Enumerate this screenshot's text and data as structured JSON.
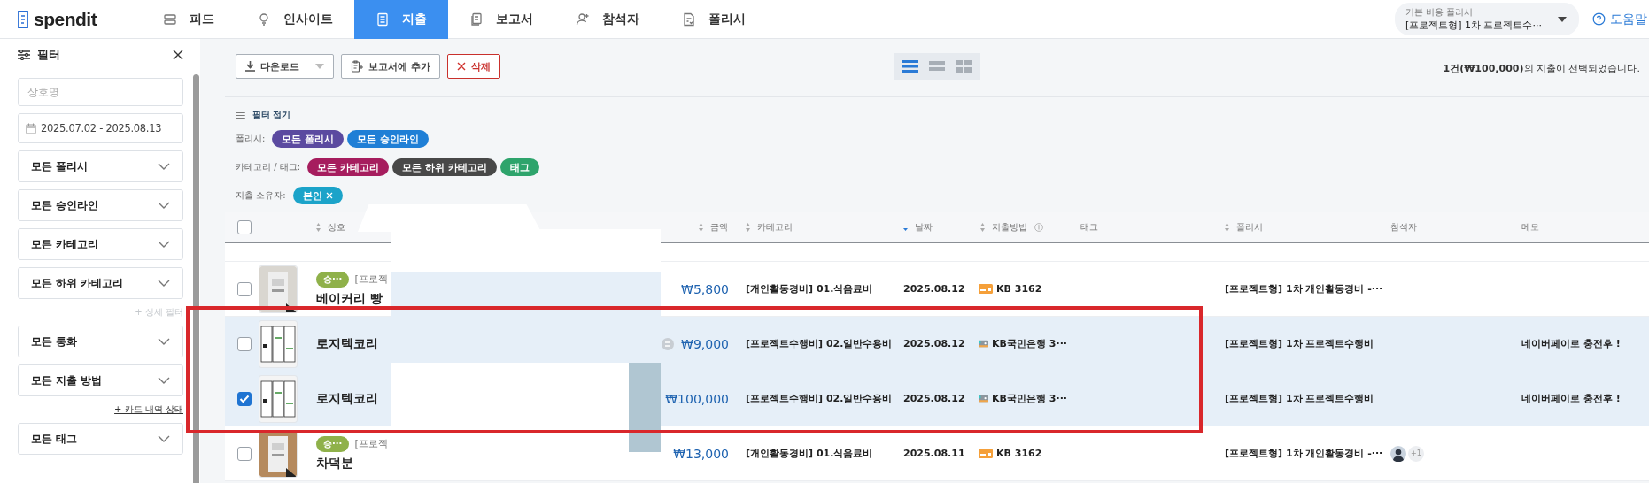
{
  "nav": {
    "logo": "spendit",
    "items": [
      {
        "label": "피드",
        "selected": false
      },
      {
        "label": "인사이트",
        "selected": false
      },
      {
        "label": "지출",
        "selected": true
      },
      {
        "label": "보고서",
        "selected": false
      },
      {
        "label": "참석자",
        "selected": false
      },
      {
        "label": "폴리시",
        "selected": false
      }
    ],
    "policy_selector": {
      "label": "기본 비용 폴리시",
      "value": "[프로젝트형] 1차 프로젝트수···"
    },
    "help": "도움말"
  },
  "filter_panel": {
    "title": "필터",
    "fields": [
      {
        "kind": "input",
        "placeholder": "상호명"
      },
      {
        "kind": "date",
        "value": "2025.07.02 - 2025.08.13"
      },
      {
        "kind": "select",
        "value": "모든 폴리시"
      },
      {
        "kind": "select",
        "value": "모든 승인라인"
      },
      {
        "kind": "select",
        "value": "모든 카테고리"
      },
      {
        "kind": "select",
        "value": "모든 하위 카테고리"
      },
      {
        "kind": "more",
        "label": "+ 상세 필터"
      },
      {
        "kind": "select",
        "value": "모든 통화"
      },
      {
        "kind": "select",
        "value": "모든 지출 방법"
      },
      {
        "kind": "link",
        "label": "+ 카드 내역 상태"
      },
      {
        "kind": "select",
        "value": "모든 태그"
      }
    ]
  },
  "toolbar": {
    "buttons": [
      {
        "kind": "download",
        "label": "다운로드"
      },
      {
        "kind": "report",
        "label": "보고서에 추가"
      },
      {
        "kind": "delete",
        "label": "삭제"
      }
    ],
    "views": [
      {
        "kind": "list",
        "selected": true
      },
      {
        "kind": "compact",
        "selected": false
      },
      {
        "kind": "grid",
        "selected": false
      }
    ],
    "selection_summary": "**1건(₩100,000)**의 지출이 선택되었습니다."
  },
  "filters": {
    "toggle": "필터 접기",
    "groups": [
      {
        "label": "폴리시:",
        "chips": [
          {
            "label": "모든 폴리시",
            "color": "#5b4aa0",
            "removable": false
          },
          {
            "label": "모든 승인라인",
            "color": "#1f7fd6",
            "removable": false
          }
        ]
      },
      {
        "label": "카테고리 / 태그:",
        "chips": [
          {
            "label": "모든 카테고리",
            "color": "#a61d5e",
            "removable": false
          },
          {
            "label": "모든 하위 카테고리",
            "color": "#484848",
            "removable": false
          },
          {
            "label": "태그",
            "color": "#2ea46c",
            "removable": false
          }
        ]
      },
      {
        "label": "지출 소유자:",
        "chips": [
          {
            "label": "본인",
            "color": "#1ba3c9",
            "removable": true
          }
        ]
      }
    ]
  },
  "table": {
    "select_all": false,
    "columns": [
      {
        "label": "상호",
        "sortable": true,
        "sorted": false
      },
      {
        "label": "금액",
        "sortable": true,
        "sorted": false
      },
      {
        "label": "카테고리",
        "sortable": true,
        "sorted": false
      },
      {
        "label": "날짜",
        "sortable": true,
        "sorted": true
      },
      {
        "label": "지출방법",
        "sortable": true,
        "sorted": false,
        "info": true
      },
      {
        "label": "태그",
        "sortable": false
      },
      {
        "label": "폴리시",
        "sortable": true,
        "sorted": false
      },
      {
        "label": "참석자",
        "sortable": false
      },
      {
        "label": "메모",
        "sortable": false
      }
    ],
    "rows": [
      {
        "checked": false,
        "highlighted": false,
        "status": "승···",
        "policy_tag": "[프로젝",
        "merchant": "베이커리 빵",
        "note_icon": false,
        "amount": "₩5,800",
        "category": "[개인활동경비] 01.식음료비",
        "date": "2025.08.12",
        "method": {
          "kind": "card",
          "label": "KB 3162"
        },
        "policy": "[프로젝트형] 1차 개인활동경비 -···"
      },
      {
        "checked": false,
        "highlighted": true,
        "merchant": "로지텍코리",
        "note_icon": true,
        "amount": "₩9,000",
        "category": "[프로젝트수행비] 02.일반수용비",
        "date": "2025.08.12",
        "method": {
          "kind": "bank",
          "label": "KB국민은행 3···"
        },
        "policy": "[프로젝트형] 1차 프로젝트수행비",
        "memo": "네이버페이로 충전후 !"
      },
      {
        "checked": true,
        "highlighted": true,
        "merchant": "로지텍코리",
        "note_icon": false,
        "amount": "₩100,000",
        "category": "[프로젝트수행비] 02.일반수용비",
        "date": "2025.08.12",
        "method": {
          "kind": "bank",
          "label": "KB국민은행 3···"
        },
        "policy": "[프로젝트형] 1차 프로젝트수행비",
        "memo": "네이버페이로 충전후 !"
      },
      {
        "checked": false,
        "highlighted": false,
        "status": "승···",
        "policy_tag": "[프로젝",
        "merchant": "차덕분",
        "note_icon": false,
        "amount": "₩13,000",
        "category": "[개인활동경비] 01.식음료비",
        "date": "2025.08.11",
        "method": {
          "kind": "card",
          "label": "KB 3162"
        },
        "policy": "[프로젝트형] 1차 개인활동경비 -···",
        "attendees_extra": "+1"
      }
    ]
  }
}
